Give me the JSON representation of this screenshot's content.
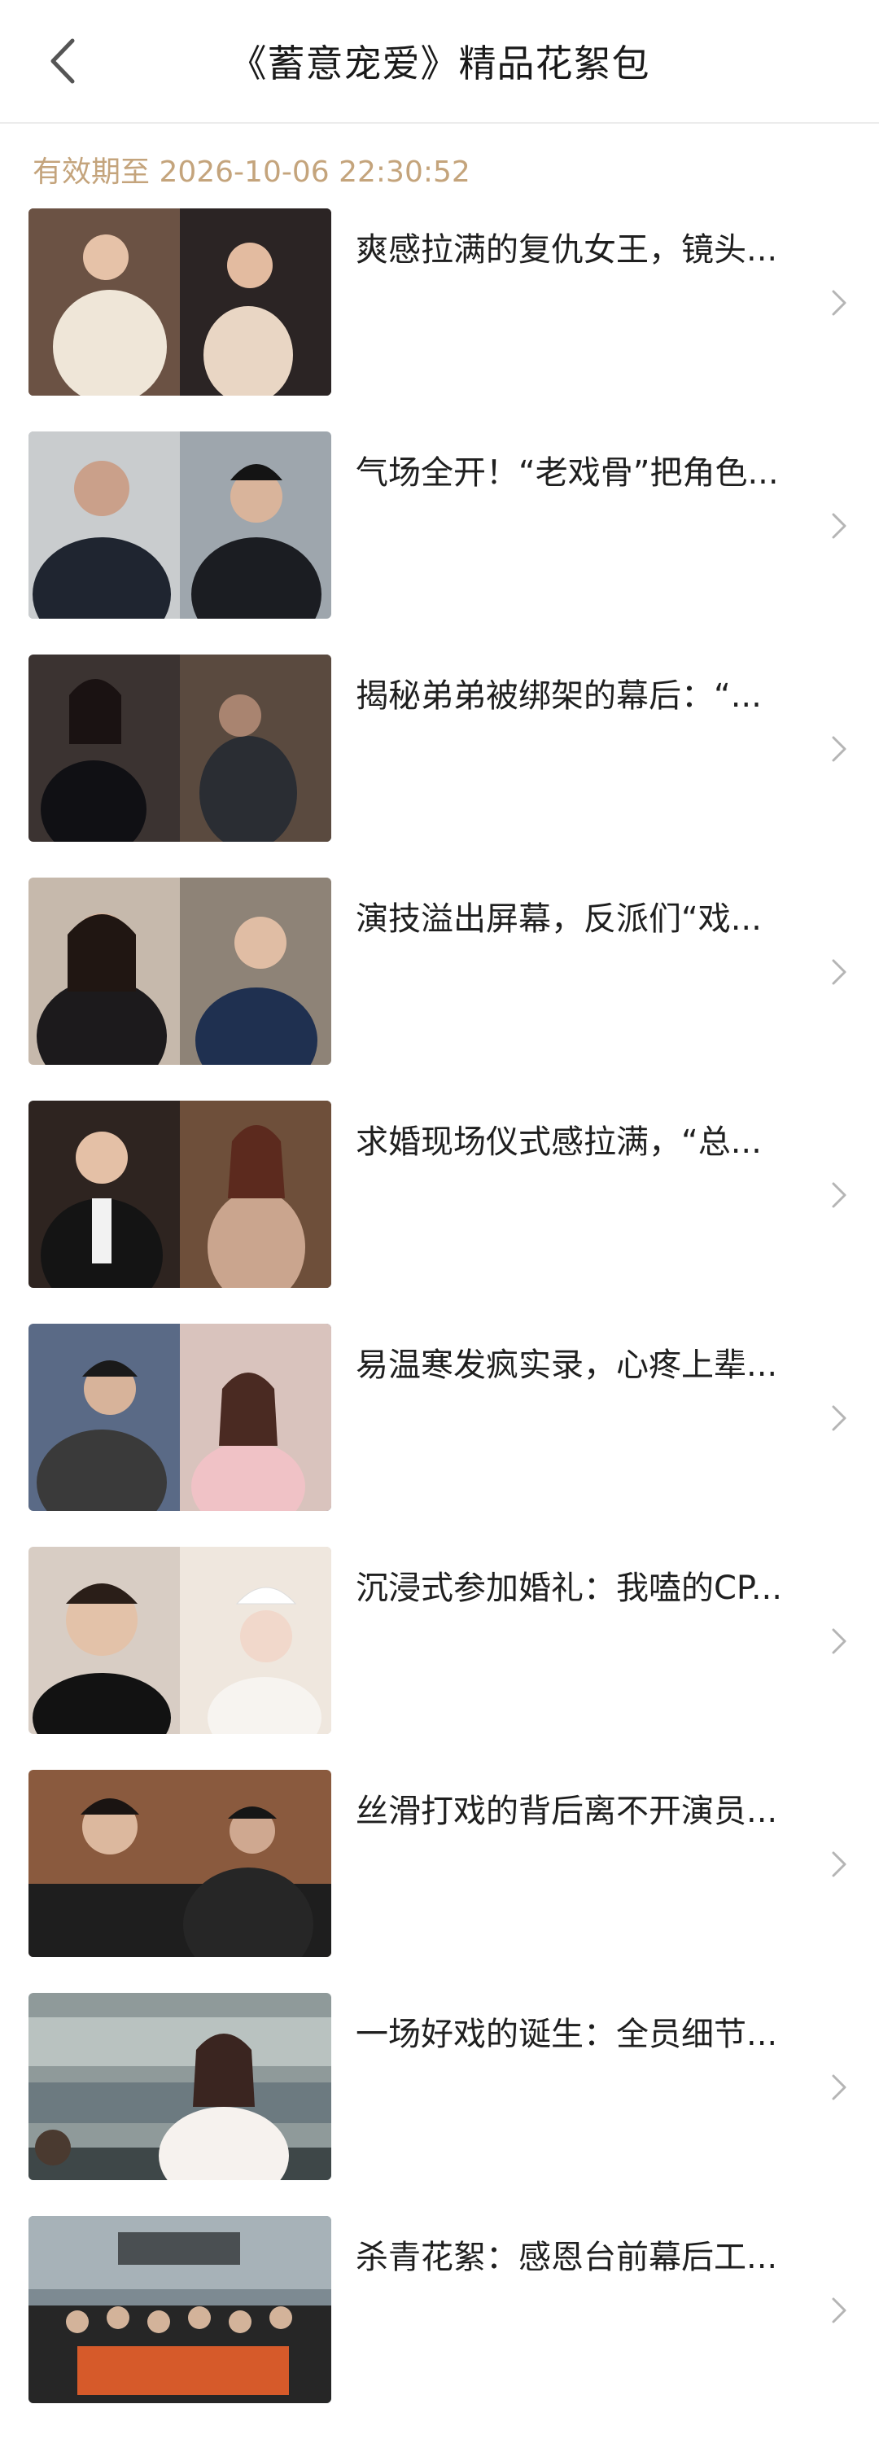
{
  "header": {
    "title": "《蓄意宠爱》精品花絮包",
    "back_icon": "chevron-left-icon"
  },
  "expiry_text": "有效期至 2026-10-06 22:30:52",
  "items": [
    {
      "title": "爽感拉满的复仇女王，镜头..."
    },
    {
      "title": "气场全开！“老戏骨”把角色..."
    },
    {
      "title": "揭秘弟弟被绑架的幕后：“..."
    },
    {
      "title": "演技溢出屏幕，反派们“戏..."
    },
    {
      "title": "求婚现场仪式感拉满，“总..."
    },
    {
      "title": "易温寒发疯实录，心疼上辈..."
    },
    {
      "title": "沉浸式参加婚礼：我嗑的CP..."
    },
    {
      "title": "丝滑打戏的背后离不开演员..."
    },
    {
      "title": "一场好戏的诞生：全员细节..."
    },
    {
      "title": "杀青花絮：感恩台前幕后工..."
    }
  ],
  "colors": {
    "expiry": "#c4a47c",
    "divider": "#ececec",
    "chevron": "#b5b5b5"
  }
}
